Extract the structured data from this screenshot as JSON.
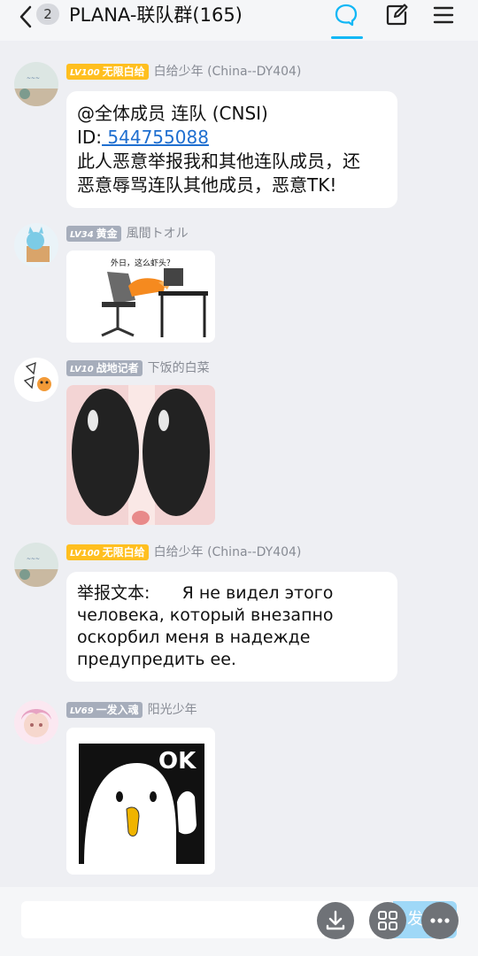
{
  "header": {
    "unread_count": "2",
    "title": "PLANA-联队群(165)"
  },
  "messages": [
    {
      "level": "LV100",
      "title": "无限白给",
      "badge_color": "#ffbf1f",
      "sender": "白给少年 (China--DY404)",
      "text_line1": "@全体成员 连队 (CNSI)",
      "id_label": "ID:",
      "id_value": " 544755088",
      "text_line3": "此人恶意举报我和其他连队成员，还",
      "text_line4": "恶意辱骂连队其他成员，恶意TK!"
    },
    {
      "level": "LV34",
      "title": "黄金",
      "badge_color": "#a6adbb",
      "sender": "風間トオル",
      "image_caption": "外日，这么虾头？"
    },
    {
      "level": "LV10",
      "title": "战地记者",
      "badge_color": "#a6adbb",
      "sender": "下饭的白菜"
    },
    {
      "level": "LV100",
      "title": "无限白给",
      "badge_color": "#ffbf1f",
      "sender": "白给少年 (China--DY404)",
      "line1": "举报文本:      Я не видел этого",
      "line2": "человека, который внезапно",
      "line3": "оскорбил меня в надежде",
      "line4": "предупредить ее."
    },
    {
      "level": "LV69",
      "title": "一发入魂",
      "badge_color": "#a6adbb",
      "sender": "阳光少年",
      "image_caption": "OK"
    }
  ],
  "input": {
    "send_label": "发"
  },
  "colors": {
    "accent": "#12b7f5",
    "link": "#1f6fd0"
  },
  "icons": {
    "back": "chevron-left-icon",
    "chat": "chat-bubble-icon",
    "edit": "edit-note-icon",
    "menu": "hamburger-menu-icon",
    "download": "download-icon",
    "apps": "grid-apps-icon",
    "more": "more-dots-icon"
  }
}
